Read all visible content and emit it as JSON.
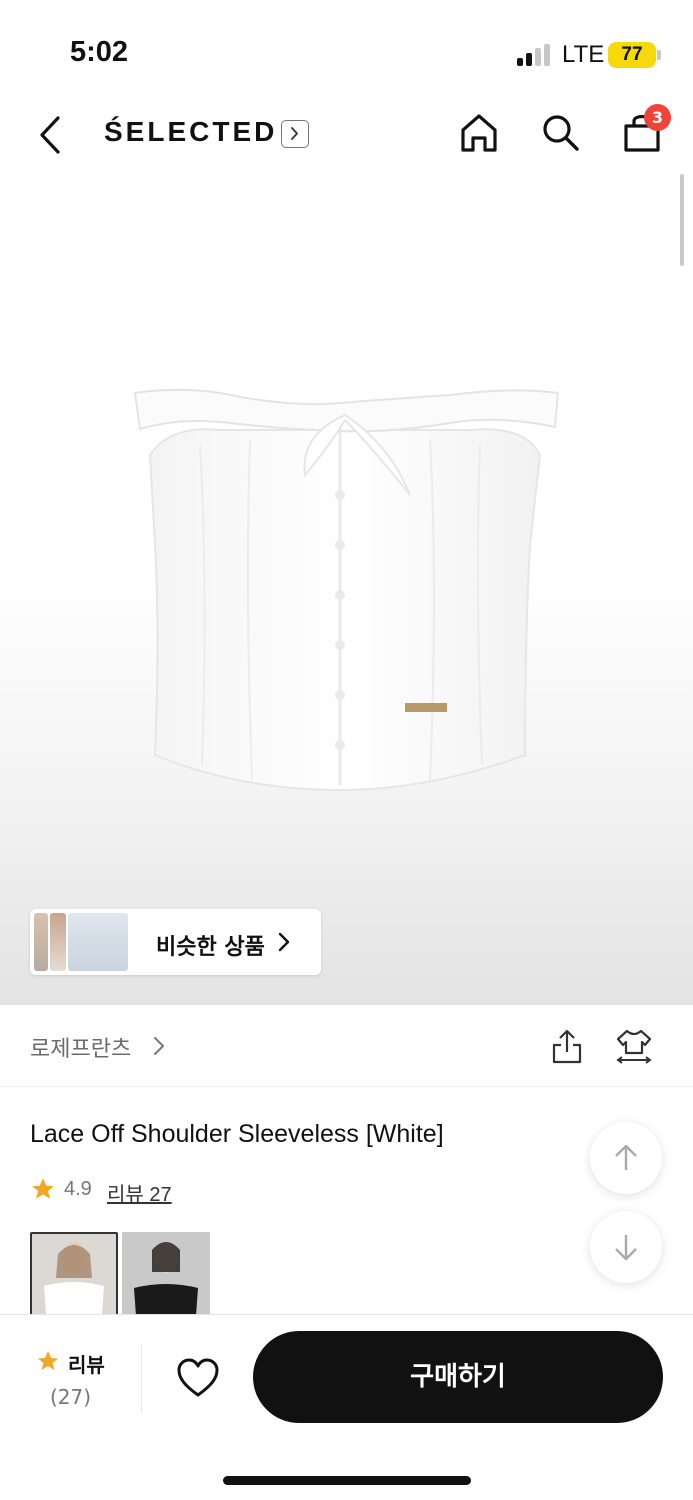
{
  "status_bar": {
    "time": "5:02",
    "network": "LTE",
    "battery": "77"
  },
  "nav": {
    "brand": "ŚELECTED",
    "cart_count": "3"
  },
  "gallery": {
    "similar_label": "비슷한 상품"
  },
  "shop": {
    "name": "로제프란츠"
  },
  "product": {
    "title": "Lace Off Shoulder Sleeveless [White]",
    "rating": "4.9",
    "review_link": "리뷰 27",
    "colors": [
      "white",
      "black"
    ]
  },
  "bottom_bar": {
    "review_label": "리뷰",
    "review_count": "(27)",
    "buy_label": "구매하기"
  },
  "colors": {
    "accent_star": "#f5a623",
    "badge": "#f0443a",
    "battery": "#f5d90a",
    "buy_button": "#111111"
  }
}
